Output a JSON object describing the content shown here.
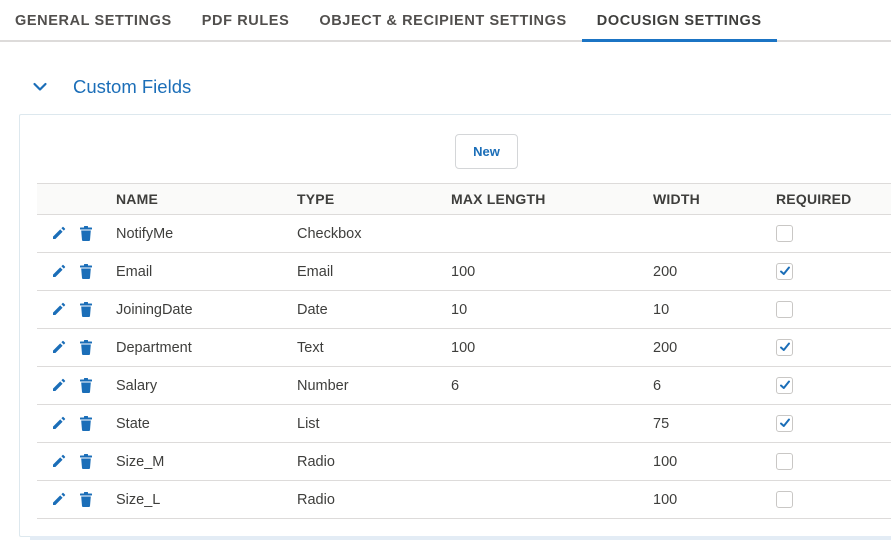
{
  "tabs": [
    {
      "label": "GENERAL SETTINGS",
      "active": false
    },
    {
      "label": "PDF RULES",
      "active": false
    },
    {
      "label": "OBJECT & RECIPIENT SETTINGS",
      "active": false
    },
    {
      "label": "DOCUSIGN SETTINGS",
      "active": true
    }
  ],
  "section": {
    "title": "Custom Fields",
    "expanded": true,
    "icon": "chevron-down-icon"
  },
  "new_button_label": "New",
  "table": {
    "columns": [
      "",
      "NAME",
      "TYPE",
      "MAX LENGTH",
      "WIDTH",
      "REQUIRED"
    ],
    "row_actions": [
      "pencil-icon",
      "trash-icon"
    ],
    "rows": [
      {
        "name": "NotifyMe",
        "type": "Checkbox",
        "max_length": "",
        "width": "",
        "required": false
      },
      {
        "name": "Email",
        "type": "Email",
        "max_length": "100",
        "width": "200",
        "required": true
      },
      {
        "name": "JoiningDate",
        "type": "Date",
        "max_length": "10",
        "width": "10",
        "required": false
      },
      {
        "name": "Department",
        "type": "Text",
        "max_length": "100",
        "width": "200",
        "required": true
      },
      {
        "name": "Salary",
        "type": "Number",
        "max_length": "6",
        "width": "6",
        "required": true
      },
      {
        "name": "State",
        "type": "List",
        "max_length": "",
        "width": "75",
        "required": true
      },
      {
        "name": "Size_M",
        "type": "Radio",
        "max_length": "",
        "width": "100",
        "required": false
      },
      {
        "name": "Size_L",
        "type": "Radio",
        "max_length": "",
        "width": "100",
        "required": false
      }
    ]
  },
  "colors": {
    "accent": "#1b74c4",
    "icon_blue": "#1b6eb8",
    "header_bg": "#fafaf9",
    "border": "#dddbda"
  }
}
